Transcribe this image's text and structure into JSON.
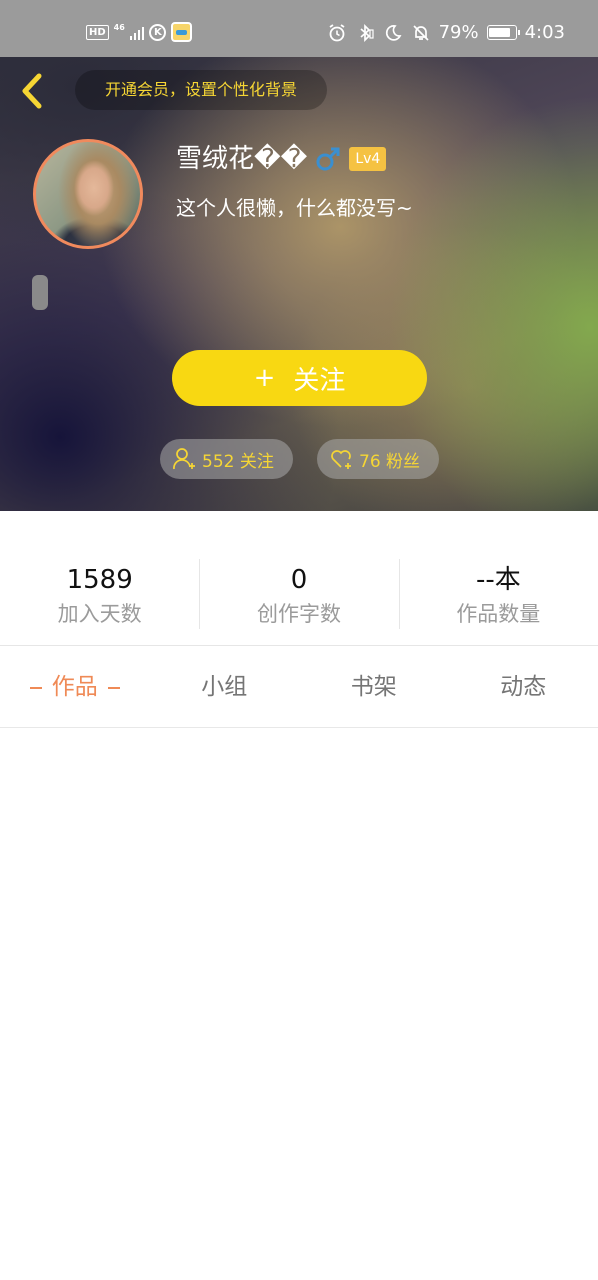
{
  "status_bar": {
    "hd": "HD",
    "network": "46",
    "k_icon": "K",
    "app_icon": "app-notification-icon",
    "battery_percent": "79%",
    "time": "4:03",
    "battery_level": 0.79
  },
  "header": {
    "vip_banner": "开通会员，设置个性化背景",
    "user_name": "雪绒花��",
    "gender": "male",
    "level": "Lv4",
    "bio": "这个人很懒，什么都没写~",
    "follow_button_plus": "+",
    "follow_button_label": "关注",
    "following_text": "552 关注",
    "fans_text": "76 粉丝"
  },
  "stats": [
    {
      "value": "1589",
      "label": "加入天数"
    },
    {
      "value": "0",
      "label": "创作字数"
    },
    {
      "value": "--本",
      "label": "作品数量"
    }
  ],
  "tabs": [
    {
      "label": "作品",
      "active": true
    },
    {
      "label": "小组",
      "active": false
    },
    {
      "label": "书架",
      "active": false
    },
    {
      "label": "动态",
      "active": false
    }
  ],
  "colors": {
    "accent_orange": "#ef8a56",
    "follow_yellow": "#f8d812",
    "pill_text_yellow": "#f6d634",
    "level_badge": "#f5c242",
    "gender_blue": "#3a8fd0"
  }
}
